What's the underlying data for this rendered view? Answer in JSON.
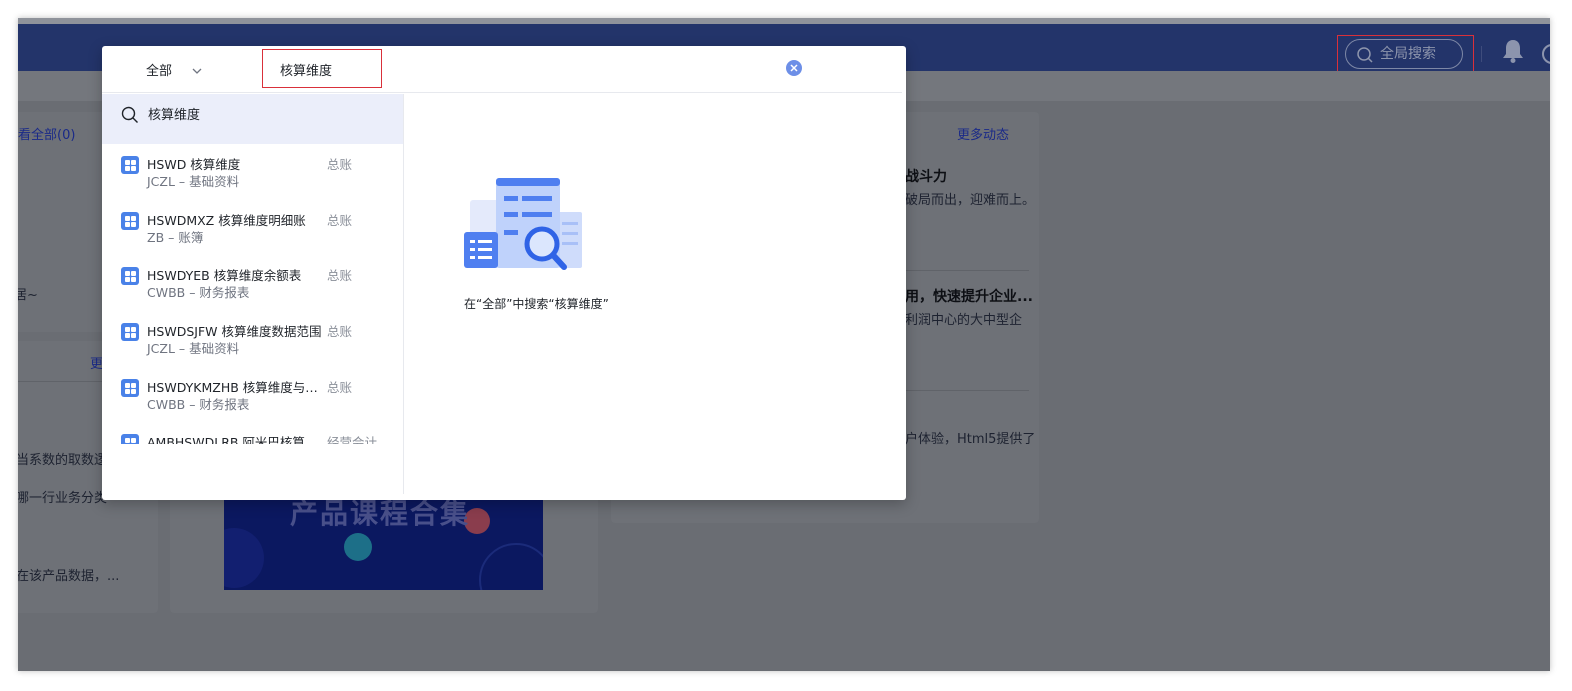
{
  "header": {
    "global_search_placeholder": "全局搜索"
  },
  "background": {
    "left_card": {
      "view_all_link": "看全部(0)",
      "text_tilde": "居~",
      "more_link": "更",
      "line1": "当系数的取数逻辑",
      "line2": "哪一行业务分类",
      "line3": "在该产品数据，..."
    },
    "banner_title": "产品课程合集",
    "right_card": {
      "more_updates_link": "更多动态",
      "news1_title": "战斗力",
      "news1_desc": "破局而出，迎难而上。",
      "news2_title": "用，快速提升企业...",
      "news2_desc": "利润中心的大中型企",
      "news3_desc": "户体验，Html5提供了"
    }
  },
  "search_modal": {
    "scope_label": "全部",
    "query": "核算维度",
    "suggestion": "核算维度",
    "results": [
      {
        "name": "HSWD 核算维度",
        "path": "JCZL – 基础资料",
        "category": "总账"
      },
      {
        "name": "HSWDMXZ 核算维度明细账",
        "path": "ZB – 账簿",
        "category": "总账"
      },
      {
        "name": "HSWDYEB 核算维度余额表",
        "path": "CWBB – 财务报表",
        "category": "总账"
      },
      {
        "name": "HSWDSJFW 核算维度数据范围",
        "path": "JCZL – 基础资料",
        "category": "总账"
      },
      {
        "name": "HSWDYKMZHB 核算维度与科目组合表",
        "path": "CWBB – 财务报表",
        "category": "总账"
      },
      {
        "name": "AMBHSWDLRB 阿米巴核算维度利润表",
        "path": "",
        "category": "经营会计"
      }
    ],
    "empty_message": "在“全部”中搜索“核算维度”"
  },
  "colors": {
    "topbar": "#23346a",
    "accent_blue": "#4a82e8",
    "highlight_red": "#d9303a",
    "suggest_bg": "#ebeefa"
  }
}
